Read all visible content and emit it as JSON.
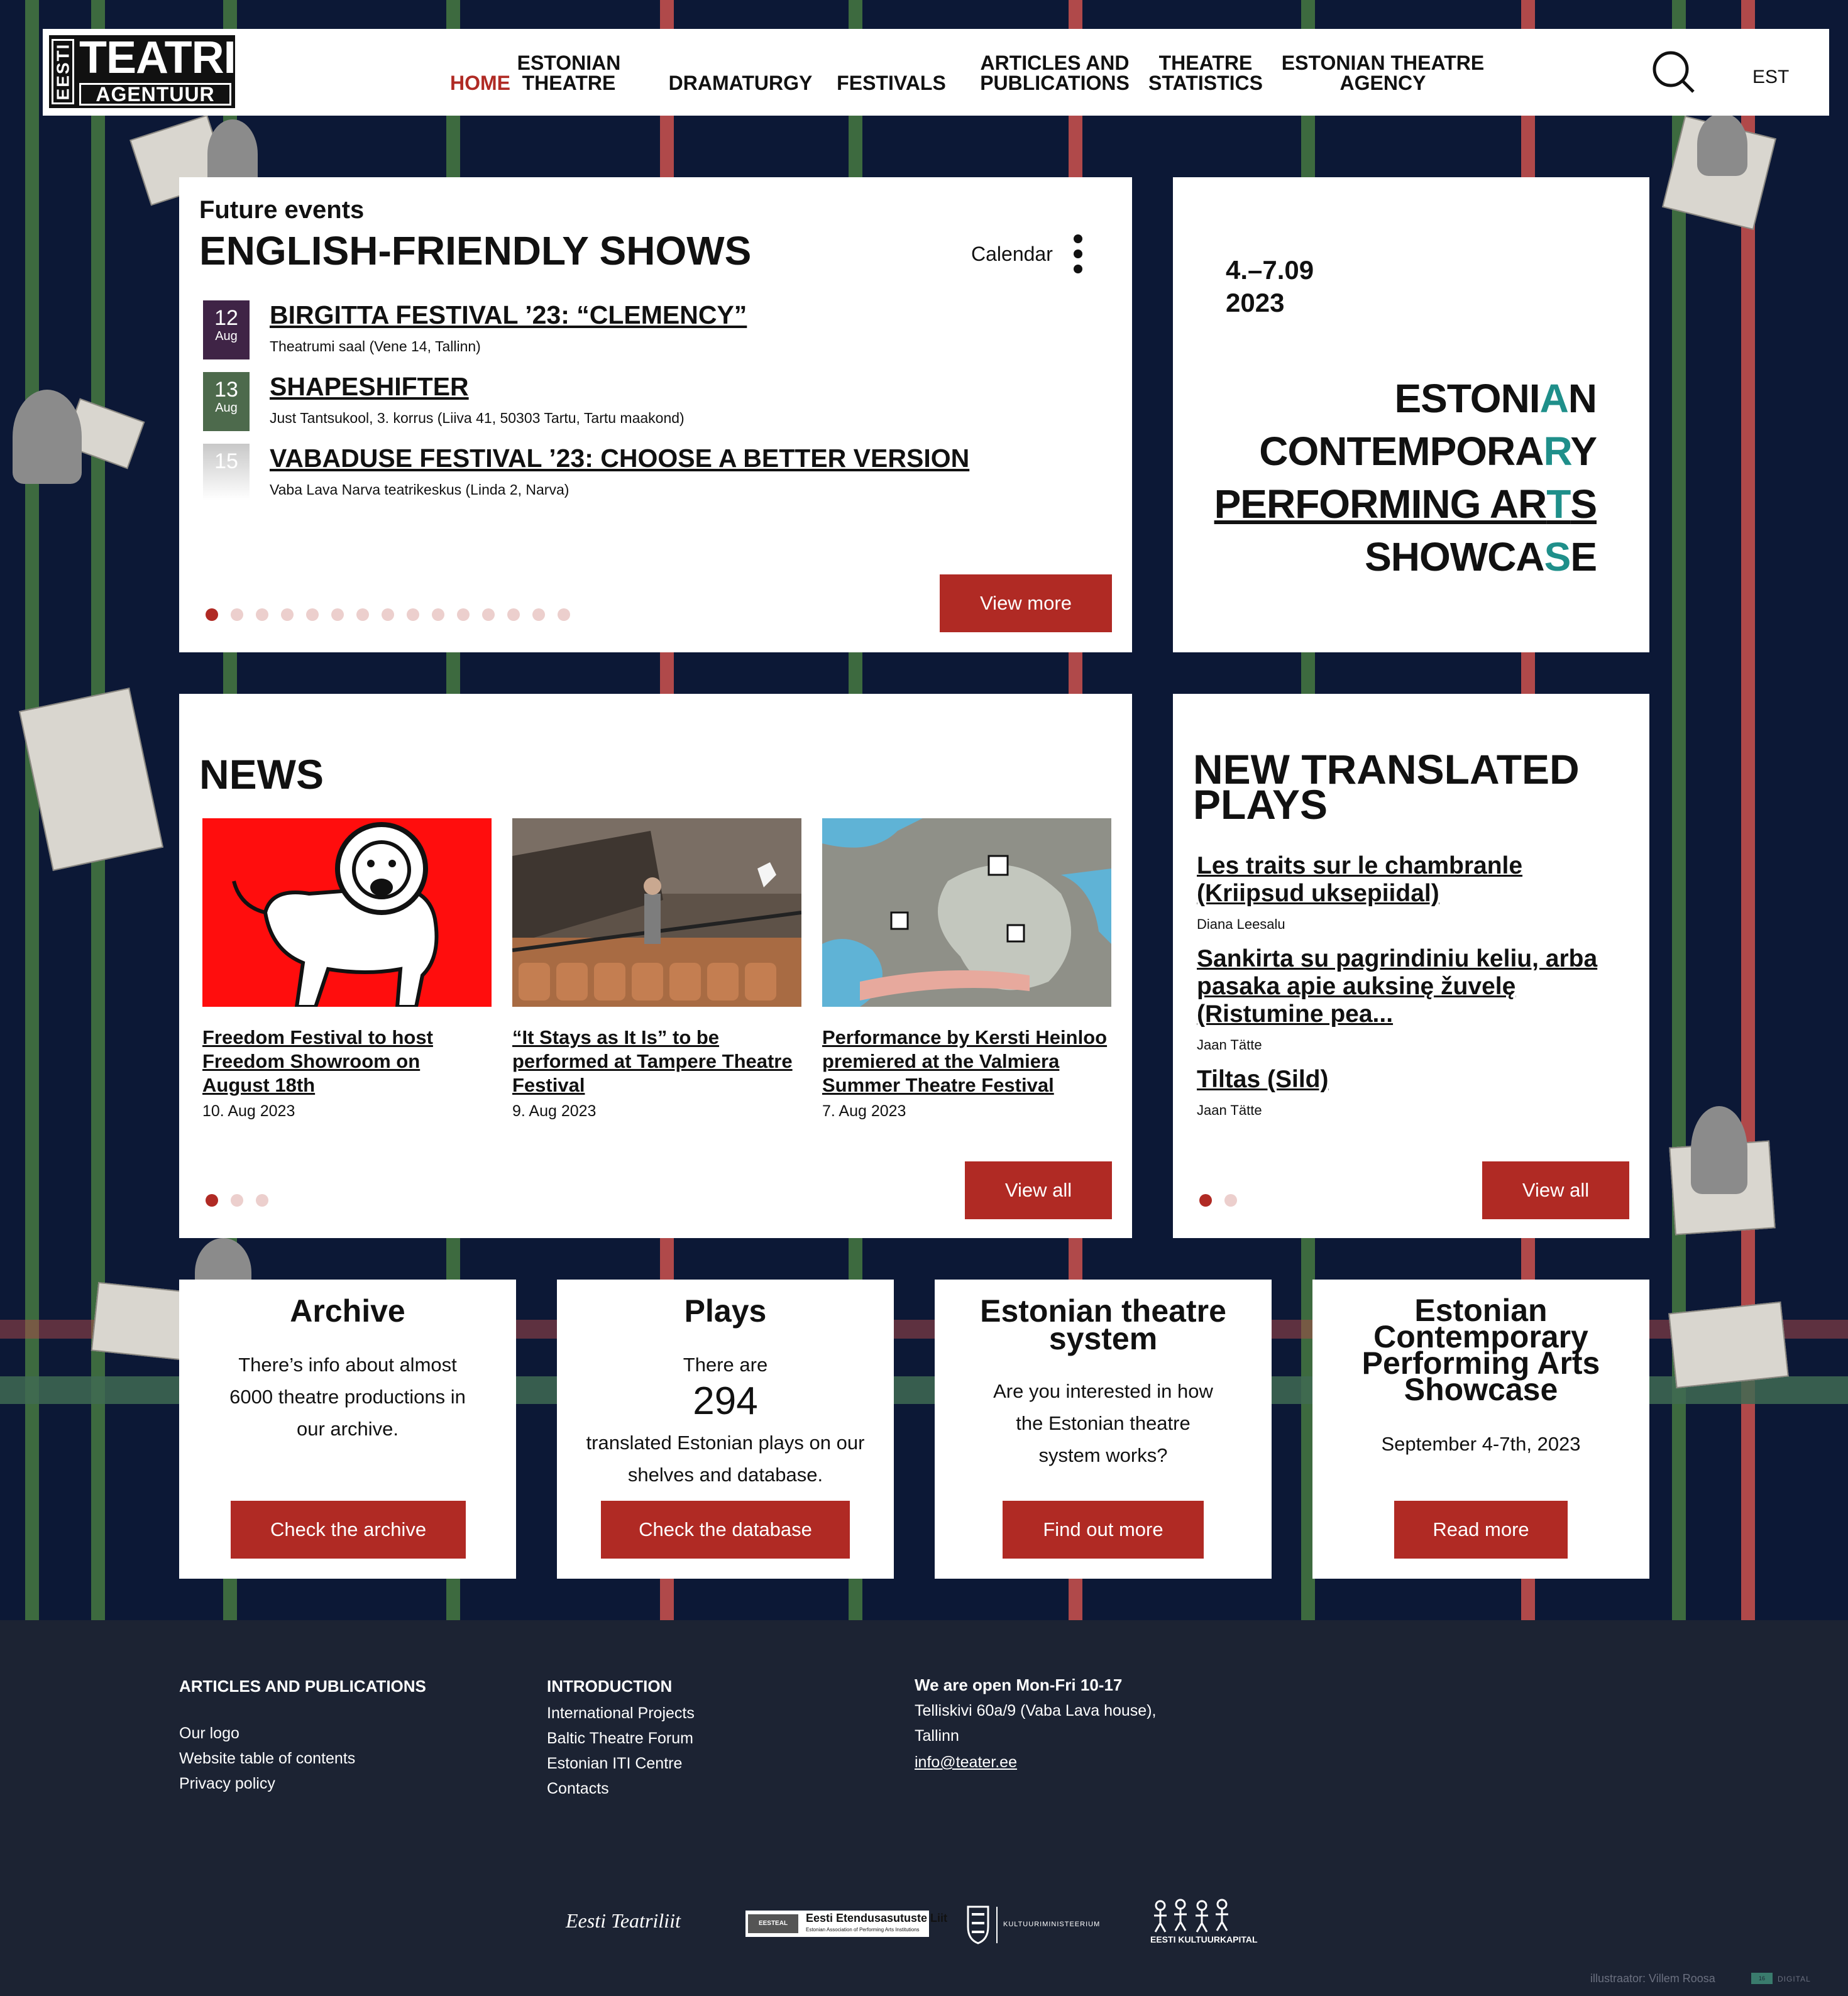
{
  "header": {
    "logo": {
      "estii": "EESTI",
      "teatri": "TEATRI",
      "agentuur": "AGENTUUR"
    },
    "nav": [
      {
        "label": "HOME",
        "active": true
      },
      {
        "label": "ESTONIAN THEATRE",
        "active": false
      },
      {
        "label": "DRAMATURGY",
        "active": false
      },
      {
        "label": "FESTIVALS",
        "active": false
      },
      {
        "label": "ARTICLES AND PUBLICATIONS",
        "active": false
      },
      {
        "label": "THEATRE STATISTICS",
        "active": false
      },
      {
        "label": "ESTONIAN THEATRE AGENCY",
        "active": false
      }
    ],
    "search_icon": "search-icon",
    "language": "EST"
  },
  "events": {
    "kicker": "Future events",
    "title": "ENGLISH-FRIENDLY SHOWS",
    "calendar_label": "Calendar",
    "items": [
      {
        "day": "12",
        "month": "Aug",
        "title": "BIRGITTA FESTIVAL ’23: “CLEMENCY”",
        "place": "Theatrumi saal (Vene 14, Tallinn)",
        "color": "#3f2446"
      },
      {
        "day": "13",
        "month": "Aug",
        "title": "SHAPESHIFTER",
        "place": "Just Tantsukool, 3. korrus (Liiva 41, 50303 Tartu, Tartu maakond)",
        "color": "#4d6a4c"
      },
      {
        "day": "15",
        "month": "Aug",
        "title": "VABADUSE FESTIVAL ’23: CHOOSE A BETTER VERSION",
        "place": "Vaba Lava Narva teatrikeskus (Linda 2, Narva)",
        "color": "#c8c8c8"
      }
    ],
    "view_more": "View more",
    "pages": 15,
    "current_page": 1
  },
  "showcase_banner": {
    "dates": "4.–7.09",
    "year": "2023",
    "lines": [
      "ESTONIAN",
      "CONTEMPORARY",
      "PERFORMING ARTS",
      "SHOWCASE"
    ],
    "accent_color": "#1f8f8a"
  },
  "news": {
    "title": "NEWS",
    "items": [
      {
        "title": "Freedom Festival to host Freedom Showroom on August 18th",
        "date": "10. Aug 2023"
      },
      {
        "title": "“It Stays as It Is” to be performed at Tampere Theatre Festival",
        "date": "9. Aug 2023"
      },
      {
        "title": "Performance by Kersti Heinloo premiered at the Valmiera Summer Theatre Festival",
        "date": "7. Aug 2023"
      }
    ],
    "view_all": "View all",
    "pages": 3
  },
  "translated": {
    "title": "NEW TRANSLATED PLAYS",
    "items": [
      {
        "title": "Les traits sur le chambranle (Kriipsud uksepiidal)",
        "author": "Diana Leesalu"
      },
      {
        "title": "Sankirta su pagrindiniu keliu, arba pasaka apie auksinę žuvelę (Ristumine pea...",
        "author": "Jaan Tätte"
      },
      {
        "title": "Tiltas (Sild)",
        "author": "Jaan Tätte"
      }
    ],
    "view_all": "View all",
    "pages": 2
  },
  "boxes": [
    {
      "title": "Archive",
      "text": "There’s info about almost 6000 theatre productions in our archive.",
      "button": "Check the archive"
    },
    {
      "title": "Plays",
      "text_before": "There are",
      "number": "294",
      "text_after": "translated Estonian plays on our shelves and database.",
      "button": "Check the database"
    },
    {
      "title": "Estonian theatre system",
      "text": "Are you interested in how the Estonian theatre system works?",
      "button": "Find out more"
    },
    {
      "title": "Estonian Contemporary Performing Arts Showcase",
      "text": "September 4-7th, 2023",
      "button": "Read more"
    }
  ],
  "footer": {
    "col1": {
      "heading": "ARTICLES AND PUBLICATIONS",
      "links": [
        "Our logo",
        "Website table of contents",
        "Privacy policy"
      ]
    },
    "col2": {
      "heading": "INTRODUCTION",
      "links": [
        "International Projects",
        "Baltic Theatre Forum",
        "Estonian ITI Centre",
        "Contacts"
      ]
    },
    "contact": {
      "hours": "We are open Mon-Fri 10-17",
      "address1": "Telliskivi 60a/9 (Vaba Lava house),",
      "address2": "Tallinn",
      "email": "info@teater.ee"
    },
    "partners": {
      "teatriliit": "Eesti Teatriliit",
      "eetal_short": "EESTEAL",
      "eetal": "Eesti Etendusasutuste Liit",
      "eetal_sub": "Estonian Association of Performing Arts Institutions",
      "ministry": "KULTUURIMINISTEERIUM",
      "kulkap": "EESTI KULTUURKAPITAL"
    },
    "credit": "illustraator: Villem Roosa",
    "digital": "DIGITAL",
    "digital_badge": "16"
  },
  "colors": {
    "brand_red": "#b02a24",
    "dark_blue": "#0c1836",
    "footer": "#1c2333"
  }
}
